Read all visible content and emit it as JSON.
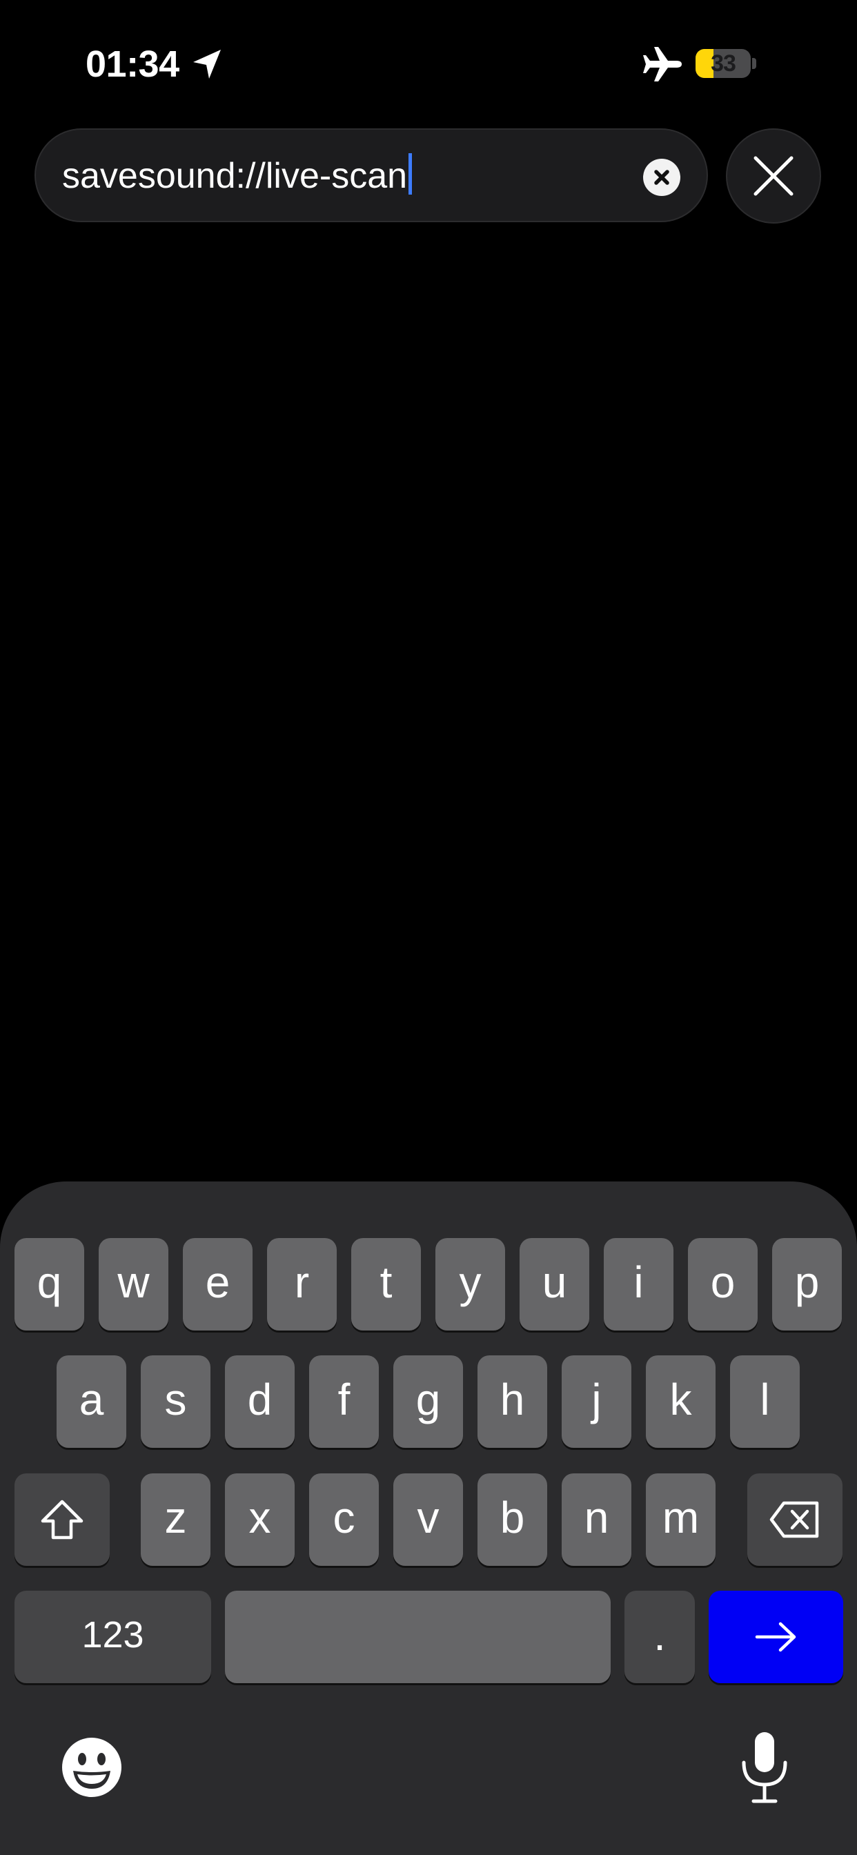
{
  "status_bar": {
    "time": "01:34",
    "battery_level": "33",
    "battery_color": "#ffd60a",
    "icons": [
      "location-arrow-icon",
      "airplane-mode-icon",
      "battery-icon"
    ]
  },
  "address_bar": {
    "value": "savesound://live-scan",
    "clear_icon": "clear-circle-icon",
    "close_icon": "close-x-icon"
  },
  "keyboard": {
    "row1": [
      "q",
      "w",
      "e",
      "r",
      "t",
      "y",
      "u",
      "i",
      "o",
      "p"
    ],
    "row2": [
      "a",
      "s",
      "d",
      "f",
      "g",
      "h",
      "j",
      "k",
      "l"
    ],
    "row3": [
      "z",
      "x",
      "c",
      "v",
      "b",
      "n",
      "m"
    ],
    "numbers_label": "123",
    "period_label": ".",
    "go_color": "#0000f5",
    "icons": [
      "shift-icon",
      "backspace-icon",
      "go-arrow-icon",
      "emoji-icon",
      "microphone-icon"
    ]
  }
}
